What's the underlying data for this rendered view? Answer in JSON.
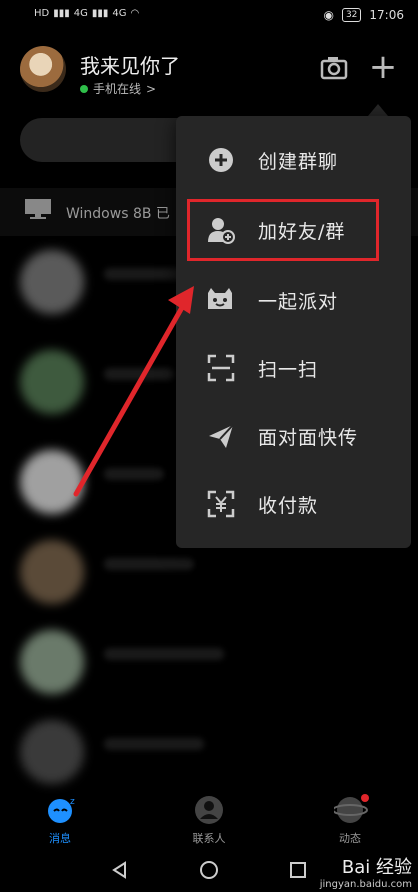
{
  "status_bar": {
    "network_labels": [
      "HD",
      "4G",
      "4G"
    ],
    "battery": "32",
    "time": "17:06"
  },
  "header": {
    "username": "我来见你了",
    "online_status": "手机在线",
    "online_chevron": ">",
    "camera_icon": "camera-icon",
    "add_icon": "plus-icon"
  },
  "device_bar": {
    "label": "Windows 8B 已"
  },
  "popup_menu": {
    "items": [
      {
        "label": "创建群聊",
        "icon": "create-group-icon"
      },
      {
        "label": "加好友/群",
        "icon": "add-friend-icon"
      },
      {
        "label": "一起派对",
        "icon": "party-icon"
      },
      {
        "label": "扫一扫",
        "icon": "scan-icon"
      },
      {
        "label": "面对面快传",
        "icon": "send-icon"
      },
      {
        "label": "收付款",
        "icon": "payment-icon"
      }
    ],
    "highlighted_index": 1
  },
  "tab_bar": {
    "tabs": [
      {
        "label": "消息",
        "active": true
      },
      {
        "label": "联系人",
        "active": false
      },
      {
        "label": "动态",
        "active": false
      }
    ]
  },
  "watermark": {
    "brand": "Bai 经验",
    "url": "jingyan.baidu.com"
  },
  "colors": {
    "accent_blue": "#1e90ff",
    "highlight_red": "#e0262b",
    "online_green": "#2fbf4a",
    "popup_bg": "#262626"
  }
}
